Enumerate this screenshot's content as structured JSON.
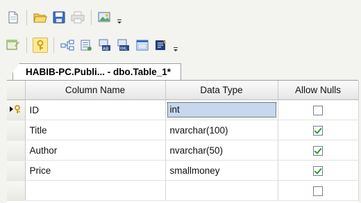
{
  "toolbar1": {
    "icons": [
      "new-document-icon",
      "open-folder-icon",
      "save-icon",
      "print-icon",
      "image-icon",
      "toolbar-options-icon"
    ]
  },
  "toolbar2": {
    "icons": [
      "table-designer-icon",
      "primary-key-icon",
      "relationships-icon",
      "indexes-icon",
      "fulltext-index-icon",
      "xml-index-icon",
      "check-constraints-icon",
      "generate-script-icon",
      "toolbar-options-icon"
    ]
  },
  "document_tab": {
    "title": "HABIB-PC.Publi... - dbo.Table_1*"
  },
  "grid": {
    "headers": {
      "column_name": "Column Name",
      "data_type": "Data Type",
      "allow_nulls": "Allow Nulls"
    },
    "rows": [
      {
        "column_name": "ID",
        "data_type": "int",
        "allow_nulls": false,
        "selected": true,
        "primary_key": true
      },
      {
        "column_name": "Title",
        "data_type": "nvarchar(100)",
        "allow_nulls": true
      },
      {
        "column_name": "Author",
        "data_type": "nvarchar(50)",
        "allow_nulls": true
      },
      {
        "column_name": "Price",
        "data_type": "smallmoney",
        "allow_nulls": true
      },
      {
        "column_name": "",
        "data_type": "",
        "allow_nulls": false
      }
    ]
  }
}
